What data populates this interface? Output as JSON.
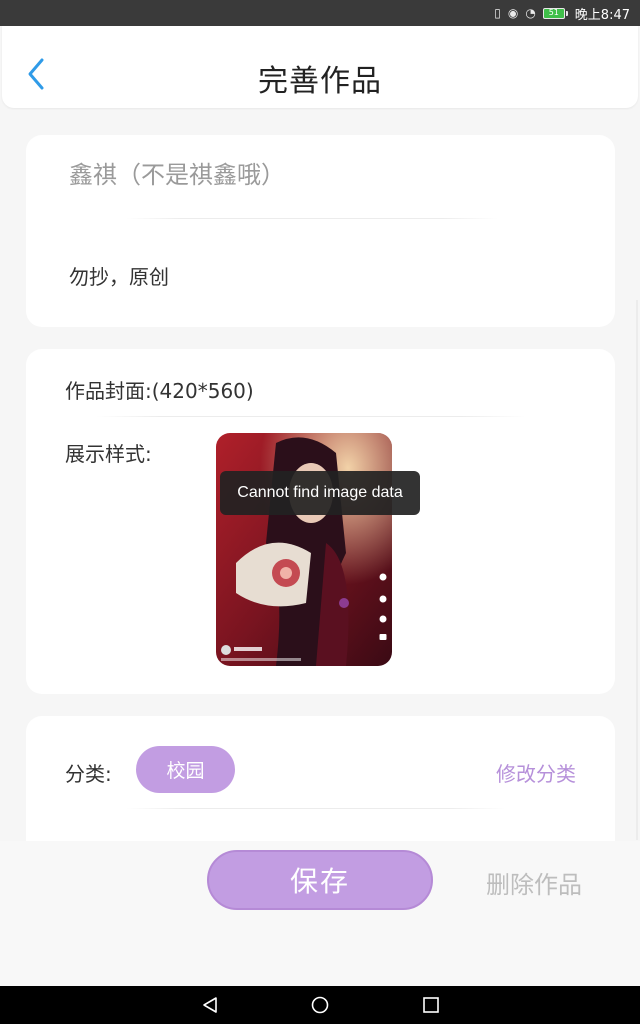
{
  "status_bar": {
    "battery": "51",
    "time": "晚上8:47",
    "icons": [
      "vibrate-icon",
      "eye-icon",
      "wifi-icon",
      "battery-icon"
    ]
  },
  "header": {
    "title": "完善作品",
    "back_icon": "chevron-left-icon"
  },
  "work": {
    "title": "鑫祺（不是祺鑫哦）",
    "description": "勿抄，原创"
  },
  "cover": {
    "label": "作品封面:(420*560)",
    "style_label": "展示样式:",
    "toast": "Cannot find image data"
  },
  "classification": {
    "category_label": "分类:",
    "category_value": "校园",
    "category_action": "修改分类"
  },
  "actions": {
    "save": "保存",
    "delete": "删除作品"
  },
  "colors": {
    "accent": "#c29de2",
    "link": "#b690da",
    "back_icon": "#2f9be8",
    "muted": "#bdbdbd"
  }
}
